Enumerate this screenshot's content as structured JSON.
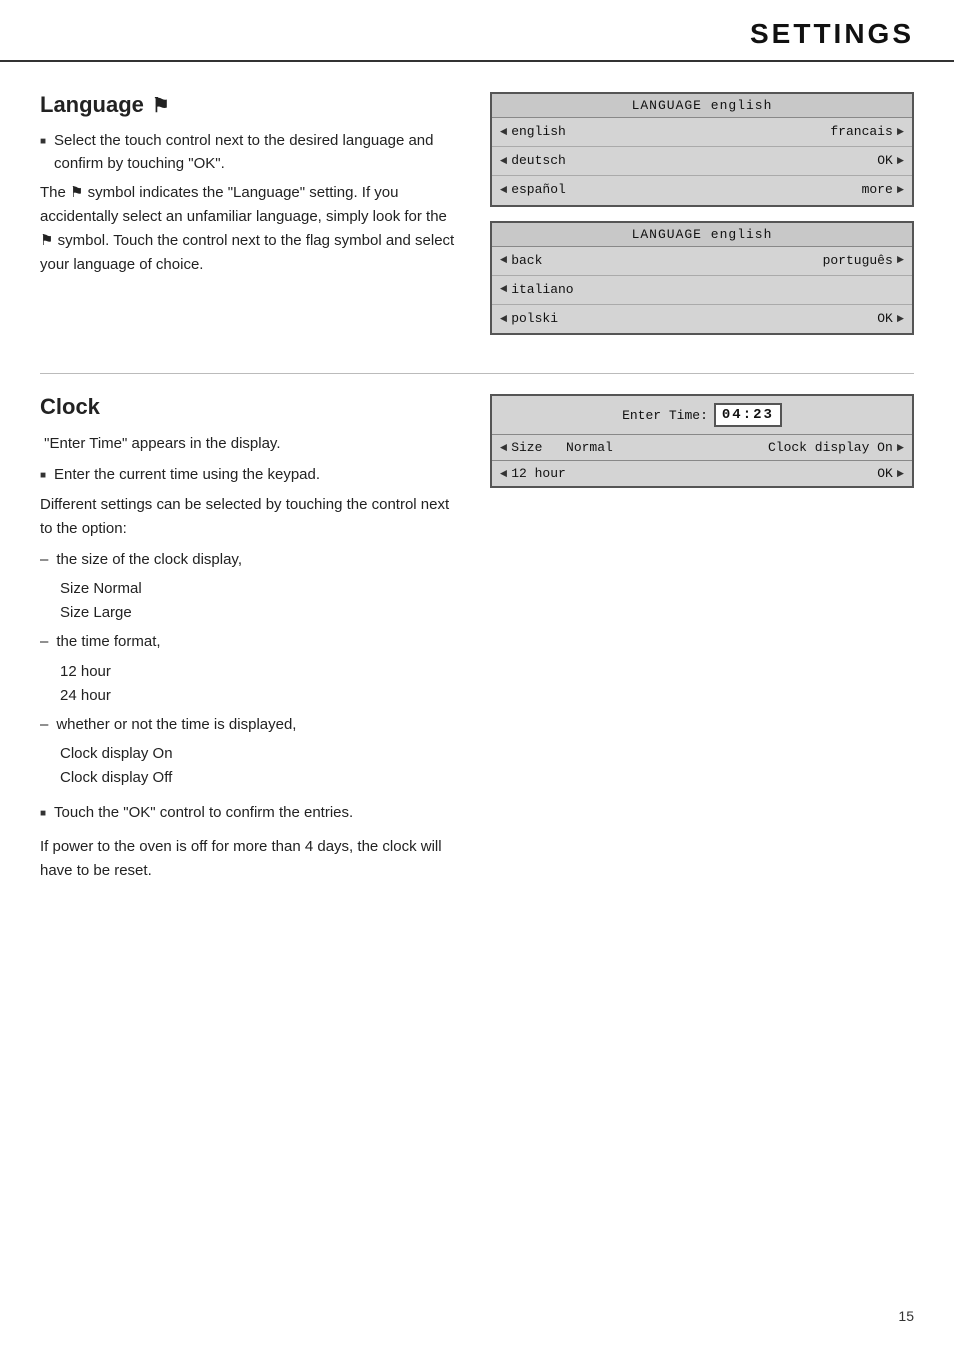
{
  "header": {
    "title": "SETTINGS"
  },
  "language_section": {
    "title": "Language",
    "flag_symbol": "⚑",
    "instructions": [
      "Select the touch control next to the desired language and confirm by touching \"OK\"."
    ],
    "description": "The ⚑ symbol indicates the \"Language\" setting. If you accidentally select an unfamiliar language, simply look for the ⚑ symbol. Touch the control next to the flag symbol and select your language of choice.",
    "panel1": {
      "header": "LANGUAGE english",
      "rows": [
        {
          "left": "english",
          "right": "francais"
        },
        {
          "left": "deutsch",
          "right": "OK"
        },
        {
          "left": "español",
          "right": "more"
        }
      ]
    },
    "panel2": {
      "header": "LANGUAGE english",
      "rows": [
        {
          "left": "back",
          "right": "português"
        },
        {
          "left": "italiano",
          "right": ""
        },
        {
          "left": "polski",
          "right": "OK"
        }
      ]
    }
  },
  "clock_section": {
    "title": "Clock",
    "intro": "\"Enter Time\" appears in the display.",
    "bullet1": "Enter the current time using the keypad.",
    "description1": "Different settings can be selected by touching the control next to the option:",
    "dash_items": [
      {
        "label": "the size of the clock display,",
        "sub": [
          "Size Normal",
          "Size Large"
        ]
      },
      {
        "label": "the time format,",
        "sub": [
          "12 hour",
          "24 hour"
        ]
      },
      {
        "label": "whether or not the time is displayed,",
        "sub": [
          "Clock display On",
          "Clock display Off"
        ]
      }
    ],
    "bullet2": "Touch the \"OK\" control to confirm the entries.",
    "description2": "If power to the oven is off for more than 4 days, the clock will have to be reset.",
    "panel": {
      "enter_time_label": "Enter Time:",
      "time_value": "04:23",
      "row1_left": "Size",
      "row1_middle": "Normal",
      "row1_right": "Clock display  On",
      "row2_left": "12 hour",
      "row2_right": "OK"
    }
  },
  "page_number": "15"
}
